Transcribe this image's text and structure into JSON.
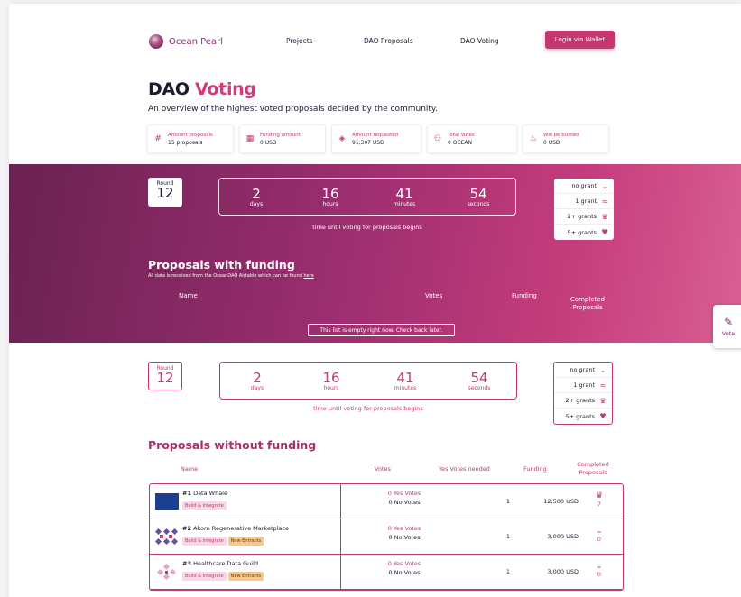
{
  "nav": {
    "brand": "Ocean Pearl",
    "links": [
      "Projects",
      "DAO Proposals",
      "DAO Voting"
    ],
    "login": "Login via Wallet"
  },
  "header": {
    "title_a": "DAO ",
    "title_b": "Voting",
    "subtitle": "An overview of the highest voted proposals decided by the community."
  },
  "stats": [
    {
      "label": "Amount proposals",
      "value": "15 proposals",
      "icon": "hash-icon"
    },
    {
      "label": "Funding amount",
      "value": "0 USD",
      "icon": "money-icon"
    },
    {
      "label": "Amount requested",
      "value": "91,307 USD",
      "icon": "tag-icon"
    },
    {
      "label": "Total Votes",
      "value": "0 OCEAN",
      "icon": "users-icon"
    },
    {
      "label": "Will be burned",
      "value": "0 USD",
      "icon": "fire-icon"
    }
  ],
  "round": {
    "label": "Round",
    "number": "12"
  },
  "timer": {
    "days": "2",
    "days_label": "days",
    "hours": "16",
    "hours_label": "hours",
    "minutes": "41",
    "minutes_label": "minutes",
    "seconds": "54",
    "seconds_label": "seconds",
    "caption": "time until voting for proposals begins"
  },
  "grants": [
    "no grant",
    "1 grant",
    "2+ grants",
    "5+ grants"
  ],
  "funded": {
    "title": "Proposals with funding",
    "note": "All data is received from the OceanDAO Airtable which can be found ",
    "note_link": "here",
    "headers": {
      "name": "Name",
      "votes": "Votes",
      "funding": "Funding",
      "completed": "Completed Proposals"
    },
    "empty": "This list is empty right now. Check back later."
  },
  "unfunded": {
    "title": "Proposals without funding",
    "headers": {
      "name": "Name",
      "votes": "Votes",
      "needed": "Yes Votes needed",
      "funding": "Funding",
      "completed": "Completed Proposals"
    },
    "rows": [
      {
        "num": "#1",
        "name": "Data Whale",
        "tags": [
          "Build & Integrate"
        ],
        "yes": "0 Yes Votes",
        "no": "0 No Votes",
        "needed": "1",
        "funding": "12,500 USD",
        "completed": "7"
      },
      {
        "num": "#2",
        "name": "Akorn Regenerative Marketplace",
        "tags": [
          "Build & Integrate",
          "New Entrants"
        ],
        "yes": "0 Yes Votes",
        "no": "0 No Votes",
        "needed": "1",
        "funding": "3,000 USD",
        "completed": "0"
      },
      {
        "num": "#3",
        "name": "Healthcare Data Guild",
        "tags": [
          "Build & Integrate",
          "New Entrants"
        ],
        "yes": "0 Yes Votes",
        "no": "0 No Votes",
        "needed": "1",
        "funding": "3,000 USD",
        "completed": "0"
      }
    ]
  },
  "vote_tab": {
    "label": "Vote"
  },
  "colors": {
    "accent": "#c2386f",
    "band_start": "#6a2252",
    "band_end": "#d95f93"
  }
}
